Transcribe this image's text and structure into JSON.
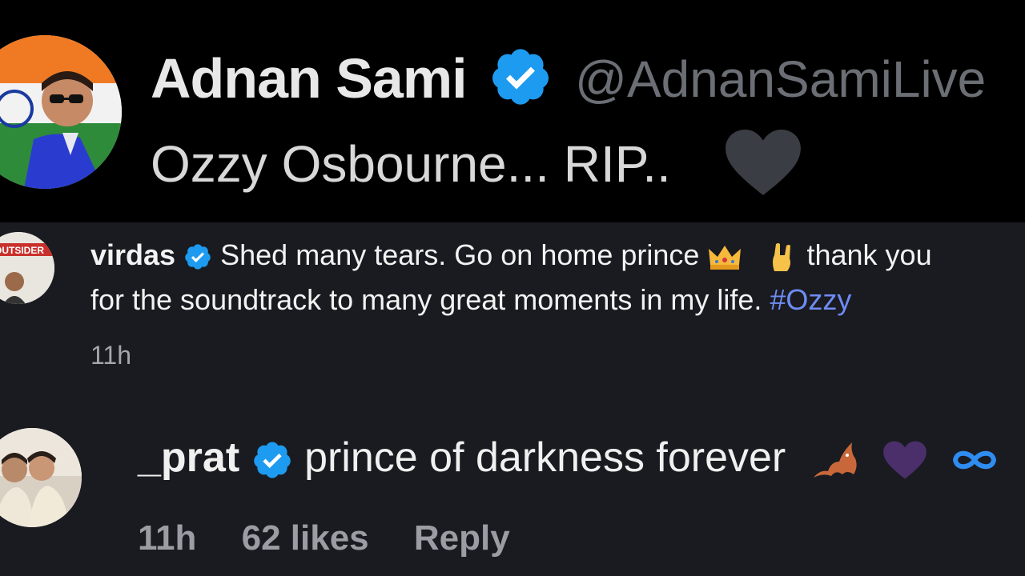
{
  "tweet": {
    "author_name": "Adnan Sami",
    "handle": "@AdnanSamiLive",
    "text": "Ozzy Osbourne... RIP..",
    "emoji_icon": "black-heart-icon"
  },
  "comments": [
    {
      "username": "virdas",
      "text_part1": "Shed many tears. Go on home prince",
      "emoji1": "crown-icon",
      "emoji2": "sign-of-horns-icon",
      "text_part2": "thank you",
      "text_line2": "for the soundtrack to many great moments in my life.",
      "hashtag": "#Ozzy",
      "time": "11h",
      "avatar_text": "OUTSIDER"
    },
    {
      "username": "_prat",
      "text": "prince of darkness forever",
      "emojis": [
        "bat-icon",
        "black-heart-icon",
        "infinity-icon"
      ],
      "time": "11h",
      "likes": "62 likes",
      "reply_label": "Reply"
    }
  ],
  "colors": {
    "verified": "#1d9bf0",
    "hashtag": "#6f8cf5",
    "background_comments": "#1a1b20",
    "background_tweet": "#000000"
  }
}
